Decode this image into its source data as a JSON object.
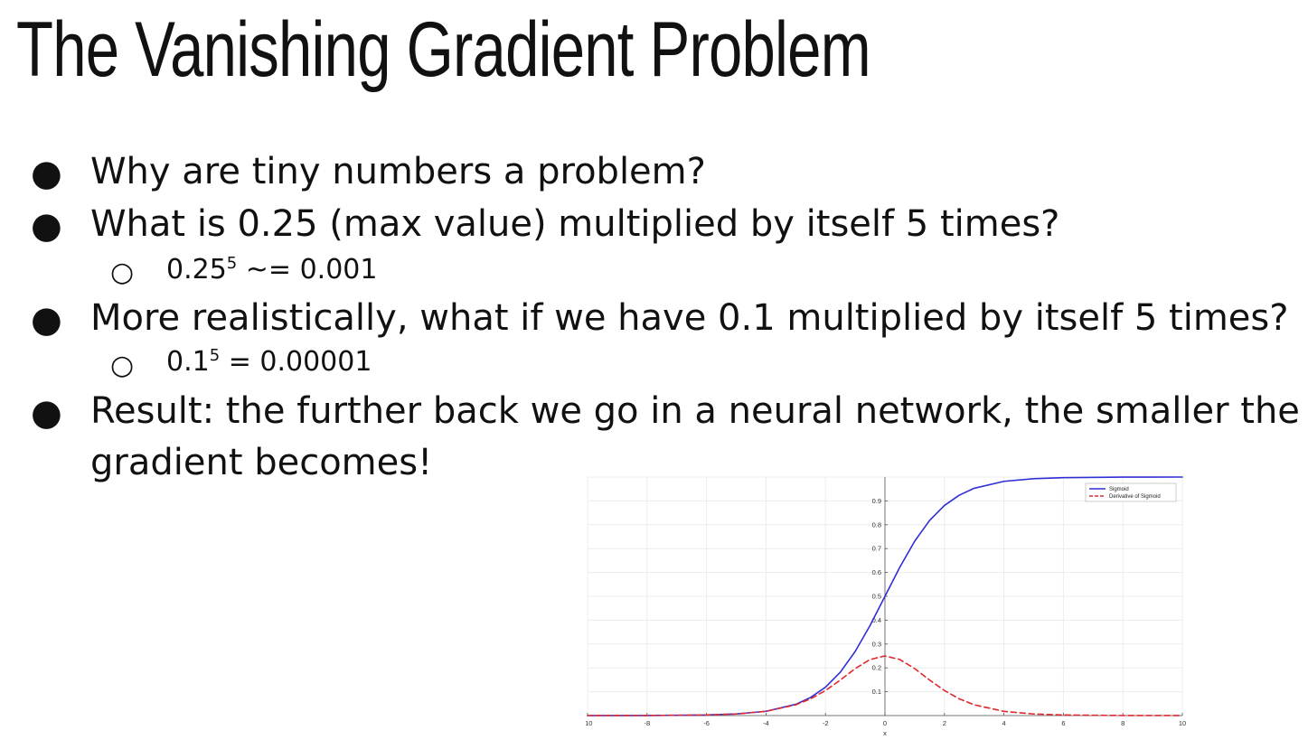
{
  "slide": {
    "title": "The Vanishing Gradient Problem",
    "bullets": [
      {
        "marker": "●",
        "text": "Why are tiny numbers a problem?"
      },
      {
        "marker": "●",
        "text": "What is 0.25 (max value) multiplied by itself 5 times?"
      },
      {
        "marker": "○",
        "base": "0.25",
        "exp": "5",
        "rest": " ~= 0.001"
      },
      {
        "marker": "●",
        "text": "More realistically, what if we have 0.1 multiplied by itself 5 times?"
      },
      {
        "marker": "○",
        "base": "0.1",
        "exp": "5",
        "rest": " = 0.00001"
      },
      {
        "marker": "●",
        "text_line1": "Result: the further back we go in a neural network, the smaller the",
        "text_line2": "gradient becomes!"
      }
    ]
  },
  "chart_data": {
    "type": "line",
    "xlabel": "x",
    "ylabel": "",
    "xlim": [
      -10,
      10
    ],
    "ylim": [
      0,
      1
    ],
    "x_ticks": [
      -10,
      -8,
      -6,
      -4,
      -2,
      0,
      2,
      4,
      6,
      8,
      10
    ],
    "x_tick_labels": [
      "-10",
      "-8",
      "-6",
      "-4",
      "-2",
      "0",
      "2",
      "4",
      "6",
      "8",
      "10"
    ],
    "y_ticks": [
      0.1,
      0.2,
      0.3,
      0.4,
      0.5,
      0.6,
      0.7,
      0.8,
      0.9
    ],
    "y_tick_labels": [
      "0.1",
      "0.2",
      "0.3",
      "0.4",
      "0.5",
      "0.6",
      "0.7",
      "0.8",
      "0.9"
    ],
    "grid": true,
    "legend_position": "top-right",
    "series": [
      {
        "name": "Sigmoid",
        "color": "#2f2fd6",
        "style": "solid",
        "x": [
          -10,
          -8,
          -6,
          -5,
          -4,
          -3,
          -2.5,
          -2,
          -1.5,
          -1,
          -0.5,
          0,
          0.5,
          1,
          1.5,
          2,
          2.5,
          3,
          4,
          5,
          6,
          8,
          10
        ],
        "y": [
          5e-05,
          0.0003,
          0.0025,
          0.0067,
          0.018,
          0.047,
          0.076,
          0.119,
          0.182,
          0.269,
          0.378,
          0.5,
          0.622,
          0.731,
          0.818,
          0.881,
          0.924,
          0.953,
          0.982,
          0.993,
          0.9975,
          0.9997,
          0.99995
        ]
      },
      {
        "name": "Derivative of Sigmoid",
        "color": "#e0282e",
        "style": "dashed",
        "x": [
          -10,
          -8,
          -6,
          -5,
          -4,
          -3,
          -2.5,
          -2,
          -1.5,
          -1,
          -0.5,
          0,
          0.5,
          1,
          1.5,
          2,
          2.5,
          3,
          4,
          5,
          6,
          8,
          10
        ],
        "y": [
          5e-05,
          0.0003,
          0.0025,
          0.0066,
          0.0177,
          0.0452,
          0.0701,
          0.105,
          0.149,
          0.197,
          0.235,
          0.25,
          0.235,
          0.197,
          0.149,
          0.105,
          0.0701,
          0.0452,
          0.0177,
          0.0066,
          0.0025,
          0.0003,
          5e-05
        ]
      }
    ]
  }
}
